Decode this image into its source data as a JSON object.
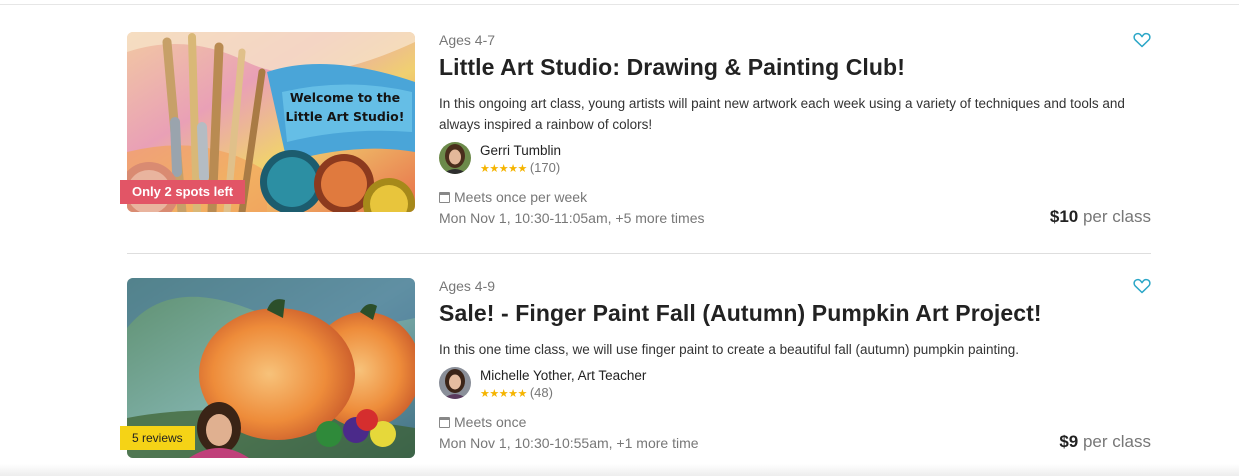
{
  "listings": [
    {
      "ages": "Ages 4-7",
      "title": "Little Art Studio: Drawing & Painting Club!",
      "description": "In this ongoing art class, young artists will paint new artwork each week using a variety of techniques and tools and always inspired a rainbow of colors!",
      "teacher": "Gerri Tumblin",
      "rating_stars": "★★★★★",
      "review_count": "(170)",
      "meets": "Meets once per week",
      "schedule": "Mon Nov 1, 10:30-11:05am, +5 more times",
      "price_amount": "$10",
      "price_unit": "per class",
      "badge": "Only 2 spots left",
      "image_caption_line1": "Welcome to the",
      "image_caption_line2": "Little Art Studio!"
    },
    {
      "ages": "Ages 4-9",
      "title": "Sale! - Finger Paint Fall (Autumn) Pumpkin Art Project!",
      "description": "In this one time class, we will use finger paint to create a beautiful fall (autumn) pumpkin painting.",
      "teacher": "Michelle Yother, Art Teacher",
      "rating_stars": "★★★★★",
      "review_count": "(48)",
      "meets": "Meets once",
      "schedule": "Mon Nov 1, 10:30-10:55am, +1 more time",
      "price_amount": "$9",
      "price_unit": "per class",
      "badge": "5 reviews"
    }
  ],
  "colors": {
    "spots_badge": "#e25566",
    "reviews_badge": "#f5d316",
    "star": "#f5b400",
    "heart": "#2aa6c7"
  },
  "icons": {
    "favorite": "heart-outline-icon",
    "calendar": "calendar-icon"
  }
}
